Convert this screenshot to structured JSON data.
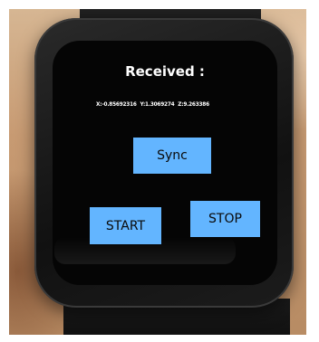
{
  "screen": {
    "title": "Received :",
    "readout": {
      "x": "X:-0.85692316",
      "y": "Y:1.3069274",
      "z": "Z:9.263386"
    }
  },
  "buttons": {
    "sync_label": "Sync",
    "start_label": "START",
    "stop_label": "STOP"
  },
  "colors": {
    "button_bg": "#63b5ff",
    "screen_bg": "#050505",
    "text": "#ffffff"
  }
}
